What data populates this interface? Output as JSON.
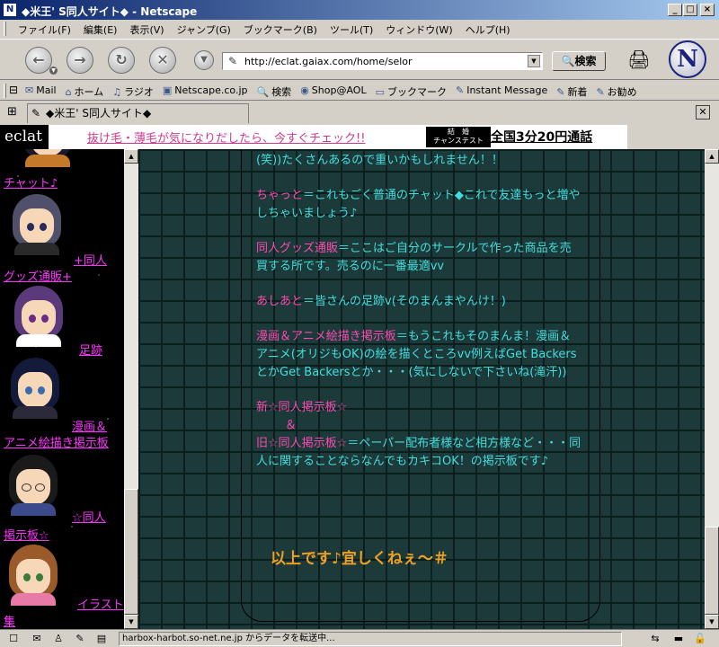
{
  "window": {
    "title": "◆米王' S同人サイト◆ - Netscape",
    "app_icon": "N"
  },
  "menu": [
    "ファイル(F)",
    "編集(E)",
    "表示(V)",
    "ジャンプ(G)",
    "ブックマーク(B)",
    "ツール(T)",
    "ウィンドウ(W)",
    "ヘルプ(H)"
  ],
  "nav": {
    "url": "http://eclat.gaiax.com/home/selor",
    "search_label": "検索",
    "logo": "N"
  },
  "personal_toolbar": [
    "Mail",
    "ホーム",
    "ラジオ",
    "Netscape.co.jp",
    "検索",
    "Shop@AOL",
    "ブックマーク",
    "Instant Message",
    "新着",
    "お勧め"
  ],
  "tab": {
    "label": "◆米王' S同人サイト◆"
  },
  "banner": {
    "logo": "eclat",
    "ad_text": "抜け毛・薄毛が気になりだしたら、今すぐチェック!!",
    "badge_line1": "結　婚",
    "badge_line2": "チャンステスト",
    "tel_text": "全国3分20円通話"
  },
  "left_menu": [
    {
      "label": "チャット♪"
    },
    {
      "label": "+同人"
    },
    {
      "label": "グッズ通販+"
    },
    {
      "label": "足跡"
    },
    {
      "label": "漫画＆"
    },
    {
      "label": "アニメ絵描き掲示板"
    },
    {
      "label": "☆同人"
    },
    {
      "label": "掲示板☆"
    },
    {
      "label": "イラスト"
    },
    {
      "label": "集"
    }
  ],
  "content": {
    "intro_tail": "(笑))たくさんあるので重いかもしれません！！",
    "p1_head": "ちゃっと",
    "p1_body": "＝これもごく普通のチャット◆これで友達もっと増やしちゃいましょう♪",
    "p2_head": "同人グッズ通販",
    "p2_body": "＝ここはご自分のサークルで作った商品を売買する所です。売るのに一番最適vv",
    "p3_head": "あしあと",
    "p3_body": "＝皆さんの足跡v(そのまんまやんけ！)",
    "p4_head": "漫画＆アニメ絵描き掲示板",
    "p4_body": "＝もうこれもそのまんま！漫画＆アニメ(オリジもOK)の絵を描くところvv例えばGet BackersとかGet Backersとか・・・(気にしないで下さいね(滝汗))",
    "p5_head": "新☆同人掲示板☆",
    "p5_amp": "＆",
    "p5_head2": "旧☆同人掲示板☆",
    "p5_body": "＝ペーパー配布者様など相方様など・・・同人に関することならなんでもカキコOK！の掲示板です♪",
    "closing": "以上です♪宜しくねぇ～＃"
  },
  "status": {
    "message": "harbox-harbot.so-net.ne.jp からデータを転送中..."
  }
}
